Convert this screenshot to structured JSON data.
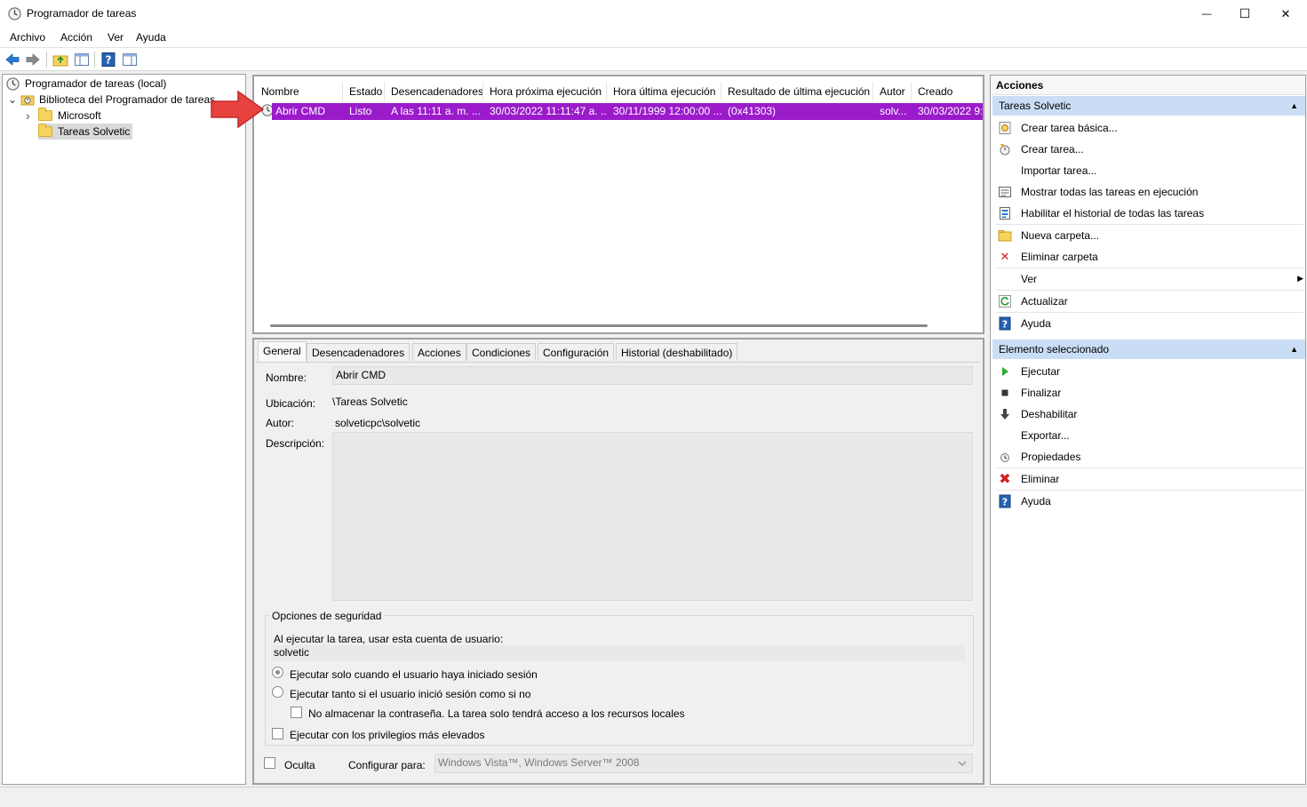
{
  "window": {
    "title": "Programador de tareas",
    "controls": {
      "minimize": "—",
      "maximize": "☐",
      "close": "✕"
    }
  },
  "menu": [
    "Archivo",
    "Acción",
    "Ver",
    "Ayuda"
  ],
  "toolbar": [
    "back-icon",
    "forward-icon",
    "folder-up-icon",
    "show-pane-icon",
    "help-icon",
    "action-pane-icon"
  ],
  "tree": {
    "root": "Programador de tareas (local)",
    "library": "Biblioteca del Programador de tareas",
    "children": [
      "Microsoft",
      "Tareas Solvetic"
    ],
    "expander_collapsed": "›",
    "expander_expanded": "⌄"
  },
  "task_table": {
    "columns": [
      "Nombre",
      "Estado",
      "Desencadenadores",
      "Hora próxima ejecución",
      "Hora última ejecución",
      "Resultado de última ejecución",
      "Autor",
      "Creado"
    ],
    "rows": [
      [
        "Abrir CMD",
        "Listo",
        "A las 11:11 a. m. ...",
        "30/03/2022 11:11:47 a. ...",
        "30/11/1999 12:00:00 ...",
        "(0x41303)",
        "solv...",
        "30/03/2022 9:"
      ]
    ]
  },
  "tabs": [
    "General",
    "Desencadenadores",
    "Acciones",
    "Condiciones",
    "Configuración",
    "Historial (deshabilitado)"
  ],
  "general": {
    "name_label": "Nombre:",
    "name_value": "Abrir CMD",
    "location_label": "Ubicación:",
    "location_value": "\\Tareas Solvetic",
    "author_label": "Autor:",
    "author_value": "solveticpc\\solvetic",
    "description_label": "Descripción:",
    "description_value": "",
    "security": {
      "title": "Opciones de seguridad",
      "account_label": "Al ejecutar la tarea, usar esta cuenta de usuario:",
      "account_value": "solvetic",
      "radio_logged_on": "Ejecutar solo cuando el usuario haya iniciado sesión",
      "radio_any": "Ejecutar tanto si el usuario inició sesión como si no",
      "no_store_password": "No almacenar la contraseña. La tarea solo tendrá acceso a los recursos locales",
      "highest_privileges": "Ejecutar con los privilegios más elevados"
    },
    "hidden_label": "Oculta",
    "configure_label": "Configurar para:",
    "configure_value": "Windows Vista™, Windows Server™ 2008"
  },
  "actions": {
    "title": "Acciones",
    "section1": {
      "title": "Tareas Solvetic",
      "items": [
        "Crear tarea básica...",
        "Crear tarea...",
        "Importar tarea...",
        "Mostrar todas las tareas en ejecución",
        "Habilitar el historial de todas las tareas",
        "Nueva carpeta...",
        "Eliminar carpeta",
        "Ver",
        "Actualizar",
        "Ayuda"
      ]
    },
    "section2": {
      "title": "Elemento seleccionado",
      "items": [
        "Ejecutar",
        "Finalizar",
        "Deshabilitar",
        "Exportar...",
        "Propiedades",
        "Eliminar",
        "Ayuda"
      ]
    },
    "collapse_glyph": "▲",
    "submenu_glyph": "▶"
  },
  "colors": {
    "selection": "#9b1bcb",
    "section_header": "#c9def5",
    "arrow": "#e8423f"
  }
}
